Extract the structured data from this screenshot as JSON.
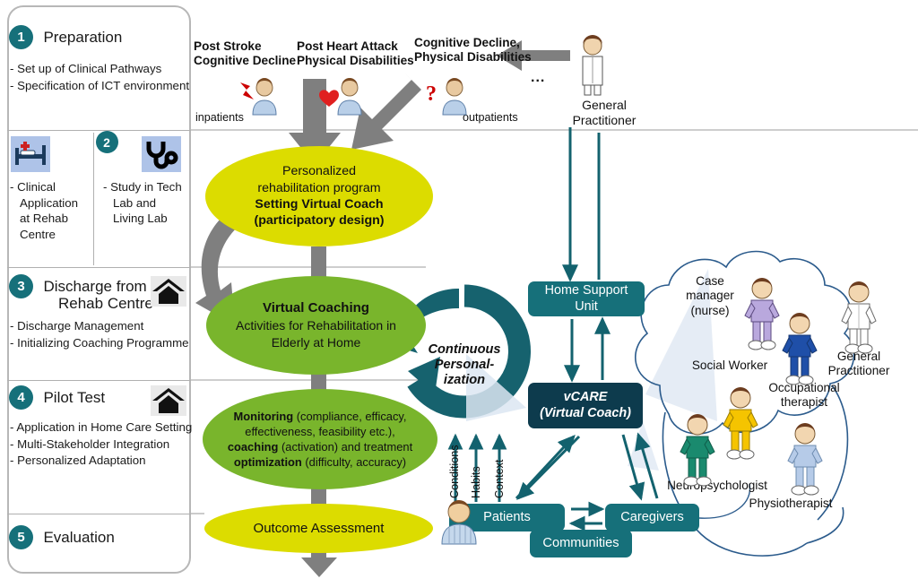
{
  "phases": [
    {
      "num": "1",
      "title": "Preparation",
      "items": [
        "-  Set up of Clinical  Pathways",
        "-  Specification of ICT environment"
      ]
    },
    {
      "num": "2",
      "title": "",
      "items_left": [
        "-  Clinical Application at Rehab Centre"
      ],
      "items_right": [
        "-  Study in Tech Lab and Living Lab"
      ],
      "icon_left": "hospital-bed-icon",
      "icon_right": "stethoscope-icon"
    },
    {
      "num": "3",
      "title": "Discharge from",
      "title2": "Rehab Centre",
      "items": [
        "-  Discharge Management",
        "-  Initializing Coaching Programme"
      ],
      "icon": "house-icon"
    },
    {
      "num": "4",
      "title": "Pilot Test",
      "items": [
        "-  Application in Home Care Setting",
        "-  Multi-Stakeholder Integration",
        "-  Personalized Adaptation"
      ],
      "icon": "house-icon"
    },
    {
      "num": "5",
      "title": "Evaluation",
      "items": []
    }
  ],
  "patient_sources": {
    "label_a_line1": "Post Stroke",
    "label_a_line2": "Cognitive Decline",
    "label_b_line1": "Post Heart Attack",
    "label_b_line2": "Physical Disabilities",
    "label_c_line1": "Cognitive Decline,",
    "label_c_line2": "Physical Disabilities",
    "inpatients": "inpatients",
    "outpatients": "outpatients",
    "ellipsis": "...",
    "gp_line1": "General",
    "gp_line2": "Practitioner",
    "icon_a": "patient-stroke-icon",
    "icon_b": "patient-heart-icon",
    "icon_c": "patient-question-icon",
    "icon_gp": "general-practitioner-icon"
  },
  "flow": {
    "prp_line1": "Personalized",
    "prp_line2": "rehabilitation program",
    "prp_line3": "Setting Virtual Coach",
    "prp_line4": "(participatory design)",
    "vc_line1": "Virtual Coaching",
    "vc_line2": "Activities for Rehabilitation in",
    "vc_line3": "Elderly at Home",
    "mon_b1": "Monitoring",
    "mon_t1": " (compliance, efficacy,",
    "mon_t2": "effectiveness, feasibility etc.),",
    "mon_b2": "coaching",
    "mon_t3": " (activation) and treatment",
    "mon_b3": "optimization",
    "mon_t4": " (difficulty, accuracy)",
    "outcome": "Outcome Assessment"
  },
  "personalization": {
    "line1": "Continuous",
    "line2": "Personal-",
    "line3": "ization"
  },
  "system": {
    "home_support_line1": "Home Support",
    "home_support_line2": "Unit",
    "vcare_line1": "vCARE",
    "vcare_line2": "(Virtual Coach)",
    "patients": "Patients",
    "caregivers": "Caregivers",
    "communities": "Communities",
    "patient_icon": "patient-avatar-icon"
  },
  "signals": [
    "Conditions",
    "Habits",
    "Context"
  ],
  "stakeholders": [
    {
      "id": "case-manager",
      "line1": "Case",
      "line2": "manager",
      "line3": "(nurse)",
      "color": "#b9a8dd"
    },
    {
      "id": "social-worker",
      "line1": "Social Worker",
      "color": "#b9a8dd"
    },
    {
      "id": "general-practitioner",
      "line1": "General",
      "line2": "Practitioner",
      "color": "#ffffff"
    },
    {
      "id": "occupational-therapist",
      "line1": "Occupational",
      "line2": "therapist",
      "color": "#1f4fa8"
    },
    {
      "id": "neuropsychologist",
      "line1": "Neuropsychologist",
      "color": "#1a8a6e"
    },
    {
      "id": "physiotherapist",
      "line1": "Physiotherapist",
      "color": "#b6cbe8"
    }
  ],
  "colors": {
    "teal": "#16707a",
    "dark_navy": "#0d3b4d",
    "green": "#79b52c",
    "yellow": "#dcdc00",
    "gray_arrow": "#7f7f7f",
    "cloud_outline": "#2b5b8c",
    "panel_border": "#b7b7b7"
  }
}
